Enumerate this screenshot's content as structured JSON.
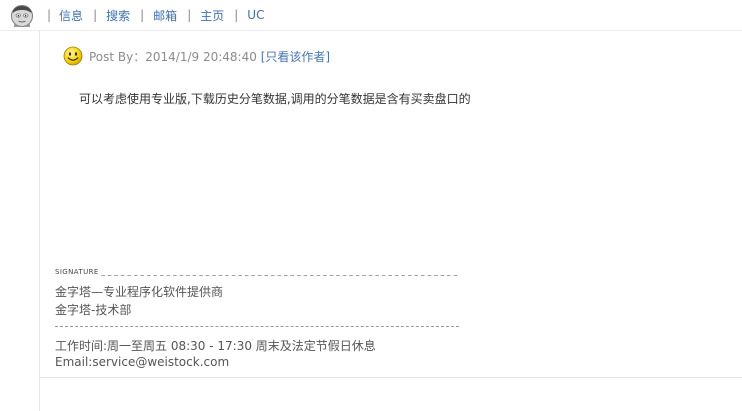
{
  "nav": {
    "items": [
      "信息",
      "搜索",
      "邮箱",
      "主页",
      "UC"
    ]
  },
  "post": {
    "meta": "Post By：2014/1/9 20:48:40",
    "author_link": "[只看该作者]",
    "body": "可以考虑使用专业版,下载历史分笔数据,调用的分笔数据是含有买卖盘口的"
  },
  "signature": {
    "label": "SIGNATURE",
    "lines": [
      "金字塔—专业程序化软件提供商",
      "金字塔-技术部",
      "工作时间:周一至周五 08:30 - 17:30   周末及法定节假日休息",
      "Email:service@weistock.com"
    ]
  },
  "icons": {
    "avatar": "user-avatar-icon",
    "smiley": "smiley-face-icon"
  },
  "colors": {
    "link": "#3f6fb4",
    "meta_text": "#8c8c8c",
    "body_text": "#333333"
  }
}
